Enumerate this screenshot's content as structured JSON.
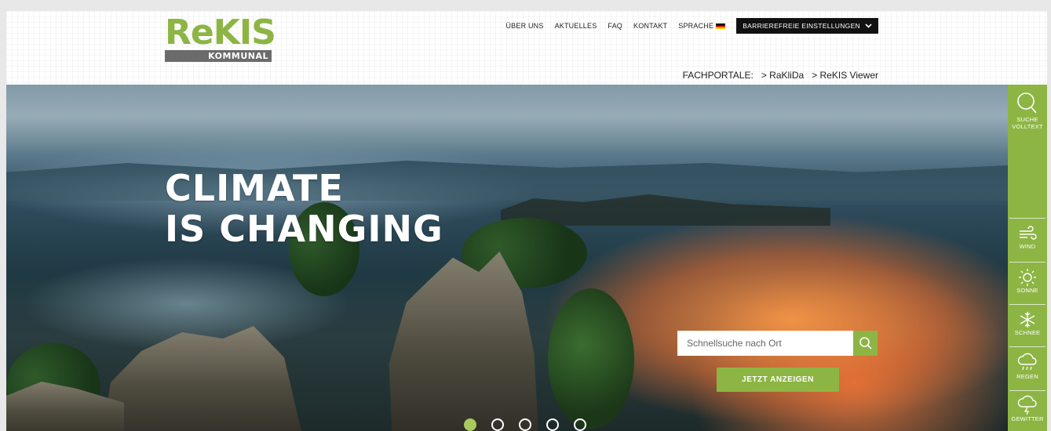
{
  "logo": {
    "main": "ReKIS",
    "sub": "KOMMUNAL"
  },
  "nav": {
    "items": [
      "ÜBER UNS",
      "AKTUELLES",
      "FAQ",
      "KONTAKT",
      "SPRACHE"
    ],
    "accessibility_button": "BARRIEREFREIE EINSTELLUNGEN"
  },
  "fachportale": {
    "label": "FACHPORTALE:",
    "links": [
      "> RaKliDa",
      "> ReKIS Viewer"
    ]
  },
  "hero": {
    "headline_line1": "CLIMATE",
    "headline_line2": "IS CHANGING",
    "search_placeholder": "Schnellsuche nach Ort",
    "show_button": "JETZT ANZEIGEN",
    "slides_count": 5,
    "active_slide": 1
  },
  "sidebar": {
    "search": {
      "line1": "SUCHE",
      "line2": "VOLLTEXT"
    },
    "items": [
      "WIND",
      "SONNE",
      "SCHNEE",
      "REGEN",
      "GEWITTER"
    ]
  },
  "colors": {
    "accent": "#8db544",
    "logo_bar": "#6b6b6b",
    "dark_button": "#111111"
  },
  "icons": [
    "search-icon",
    "wind-icon",
    "sun-icon",
    "snowflake-icon",
    "rain-cloud-icon",
    "thunder-cloud-icon",
    "chevron-down-icon",
    "german-flag-icon"
  ]
}
